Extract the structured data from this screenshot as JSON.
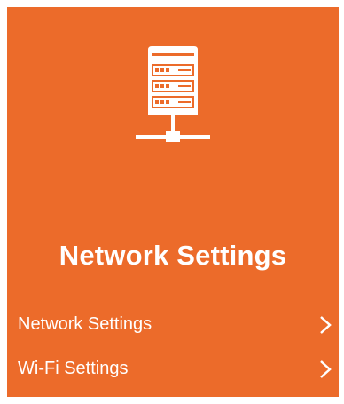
{
  "panel": {
    "background_color": "#ec6b2a",
    "icon": "server-network-icon",
    "title": "Network Settings"
  },
  "menu": {
    "items": [
      {
        "label": "Network Settings",
        "icon": "chevron-right-icon"
      },
      {
        "label": "Wi-Fi Settings",
        "icon": "chevron-right-icon"
      }
    ]
  }
}
